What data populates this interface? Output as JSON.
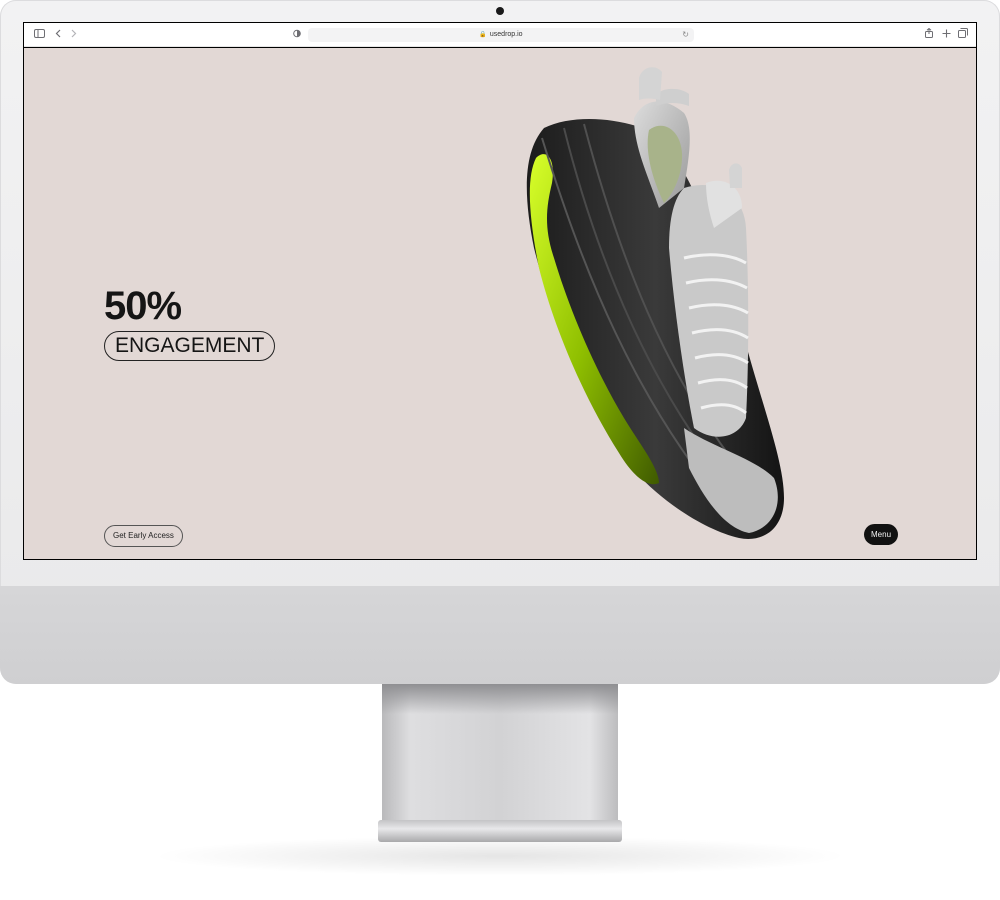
{
  "browser": {
    "url": "usedrop.io"
  },
  "hero": {
    "stat_value": "50%",
    "stat_label": "ENGAGEMENT"
  },
  "buttons": {
    "early_access": "Get Early Access",
    "menu": "Menu"
  },
  "colors": {
    "page_background": "#e2d8d5",
    "text": "#151515",
    "menu_background": "#111111",
    "accent_green": "#b8e600"
  },
  "icons": {
    "sidebar": "sidebar-icon",
    "back": "chevron-left-icon",
    "forward": "chevron-right-icon",
    "privacy": "shield-icon",
    "reload": "reload-icon",
    "share": "share-icon",
    "new_tab": "plus-icon",
    "tabs": "tabs-icon"
  }
}
